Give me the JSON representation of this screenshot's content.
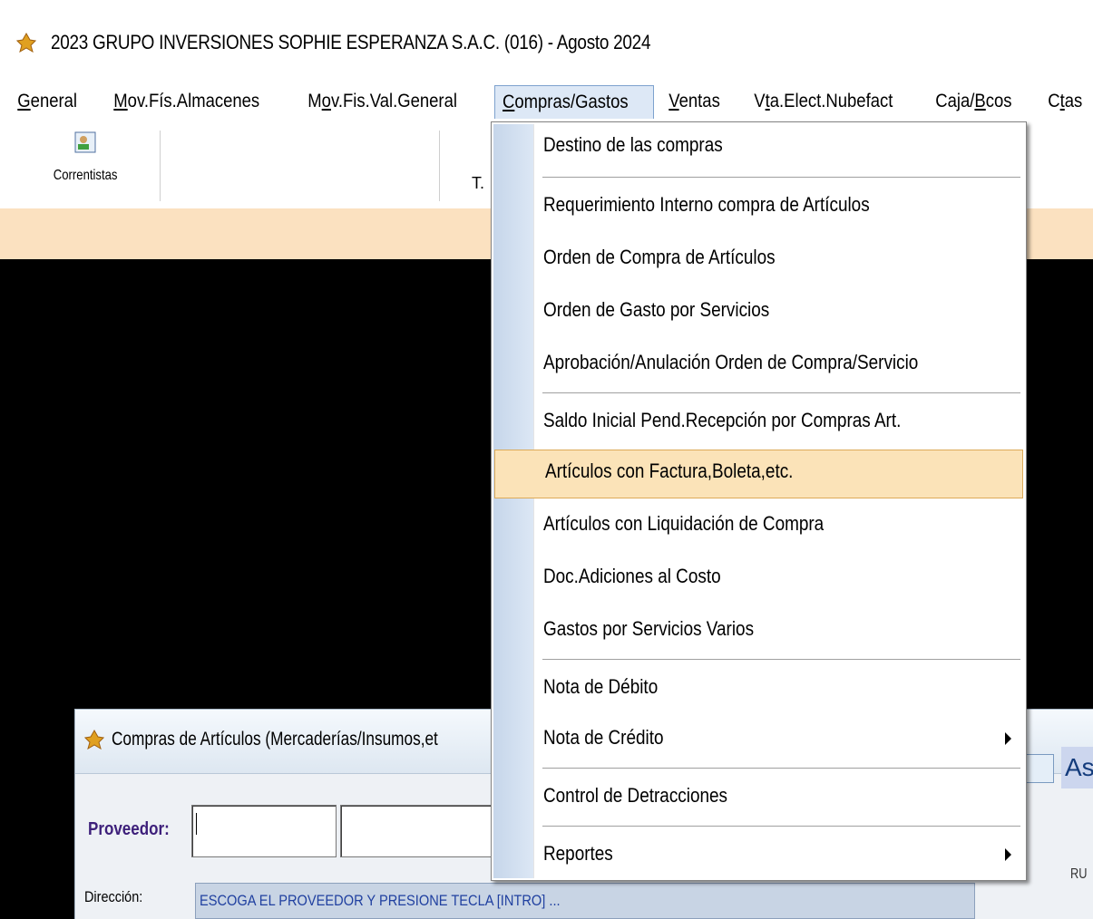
{
  "window": {
    "title": "2023 GRUPO INVERSIONES SOPHIE ESPERANZA S.A.C. (016) - Agosto 2024",
    "app_icon": "app-logo-icon"
  },
  "menubar": {
    "items": [
      {
        "label": "General",
        "mnemonic": "G"
      },
      {
        "label": "Mov.Fís.Almacenes",
        "mnemonic": "M"
      },
      {
        "label": "Mov.Fis.Val.General",
        "mnemonic": "o"
      },
      {
        "label": "Compras/Gastos",
        "mnemonic": "C"
      },
      {
        "label": "Ventas",
        "mnemonic": "V"
      },
      {
        "label": "Vta.Elect.Nubefact",
        "mnemonic": "t"
      },
      {
        "label": "Caja/Bcos",
        "mnemonic": "B"
      },
      {
        "label": "Ctas",
        "mnemonic": "t"
      }
    ]
  },
  "toolbar": {
    "correntistas_label": "Correntistas",
    "partial_label": "T."
  },
  "dropdown": {
    "items": [
      {
        "label": "Destino de las compras",
        "has_submenu": false,
        "highlighted": false
      },
      {
        "label": "Requerimiento Interno compra de Artículos",
        "has_submenu": false,
        "highlighted": false
      },
      {
        "label": "Orden de Compra de Artículos",
        "has_submenu": false,
        "highlighted": false
      },
      {
        "label": "Orden de Gasto por Servicios",
        "has_submenu": false,
        "highlighted": false
      },
      {
        "label": "Aprobación/Anulación Orden de Compra/Servicio",
        "has_submenu": false,
        "highlighted": false
      },
      {
        "label": "Saldo Inicial Pend.Recepción por Compras Art.",
        "has_submenu": false,
        "highlighted": false
      },
      {
        "label": "Artículos con Factura,Boleta,etc.",
        "has_submenu": false,
        "highlighted": true
      },
      {
        "label": "Artículos con Liquidación de Compra",
        "has_submenu": false,
        "highlighted": false
      },
      {
        "label": "Doc.Adiciones al Costo",
        "has_submenu": false,
        "highlighted": false
      },
      {
        "label": "Gastos por Servicios Varios",
        "has_submenu": false,
        "highlighted": false
      },
      {
        "label": "Nota de Débito",
        "has_submenu": false,
        "highlighted": false
      },
      {
        "label": "Nota de Crédito",
        "has_submenu": true,
        "highlighted": false
      },
      {
        "label": "Control de Detracciones",
        "has_submenu": false,
        "highlighted": false
      },
      {
        "label": "Reportes",
        "has_submenu": true,
        "highlighted": false
      }
    ]
  },
  "child_window": {
    "title": "Compras de Artículos (Mercaderías/Insumos,et",
    "proveedor_label": "Proveedor:",
    "direccion_label": "Dirección:",
    "direccion_value": "ESCOGA EL PROVEEDOR Y PRESIONE TECLA [INTRO] ...",
    "right_partial": "As",
    "right_small": "RU"
  },
  "colors": {
    "highlight_bg": "#fbe3b8",
    "highlight_border": "#dcaa58",
    "orange_band": "#fbe1c0",
    "gutter": "#c6d6ea",
    "proveedor_label": "#3d1f7a"
  }
}
